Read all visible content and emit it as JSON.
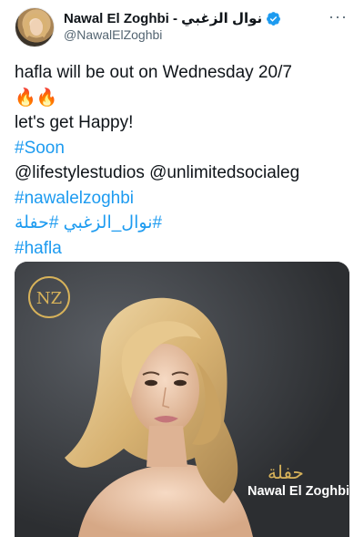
{
  "tweet": {
    "display_name": "Nawal El Zoghbi - نوال الزغبي",
    "handle": "@NawalElZoghbi",
    "more_label": "···",
    "lines": [
      {
        "text": "hafla will be out on Wednesday 20/7",
        "kind": "plain"
      },
      {
        "text": "🔥🔥",
        "kind": "plain"
      },
      {
        "text": "let's get Happy!",
        "kind": "plain"
      },
      {
        "text": "#Soon",
        "kind": "hashtag"
      },
      {
        "text": "@lifestylestudios @unlimitedsocialeg",
        "kind": "plain"
      },
      {
        "text": "#nawalelzoghbi",
        "kind": "hashtag"
      },
      {
        "text": "#نوال_الزغبي #حفلة",
        "kind": "hashtag"
      },
      {
        "text": "#hafla",
        "kind": "hashtag"
      }
    ]
  },
  "media": {
    "logo_text": "NZ",
    "caption_arabic": "حفلة",
    "caption_name": "Nawal El Zoghbi"
  },
  "colors": {
    "link": "#1d9bf0",
    "verified": "#1d9bf0",
    "gold": "#d7b25a"
  },
  "icons": {
    "verified": "verified-badge-icon",
    "more": "more-dots-icon"
  }
}
